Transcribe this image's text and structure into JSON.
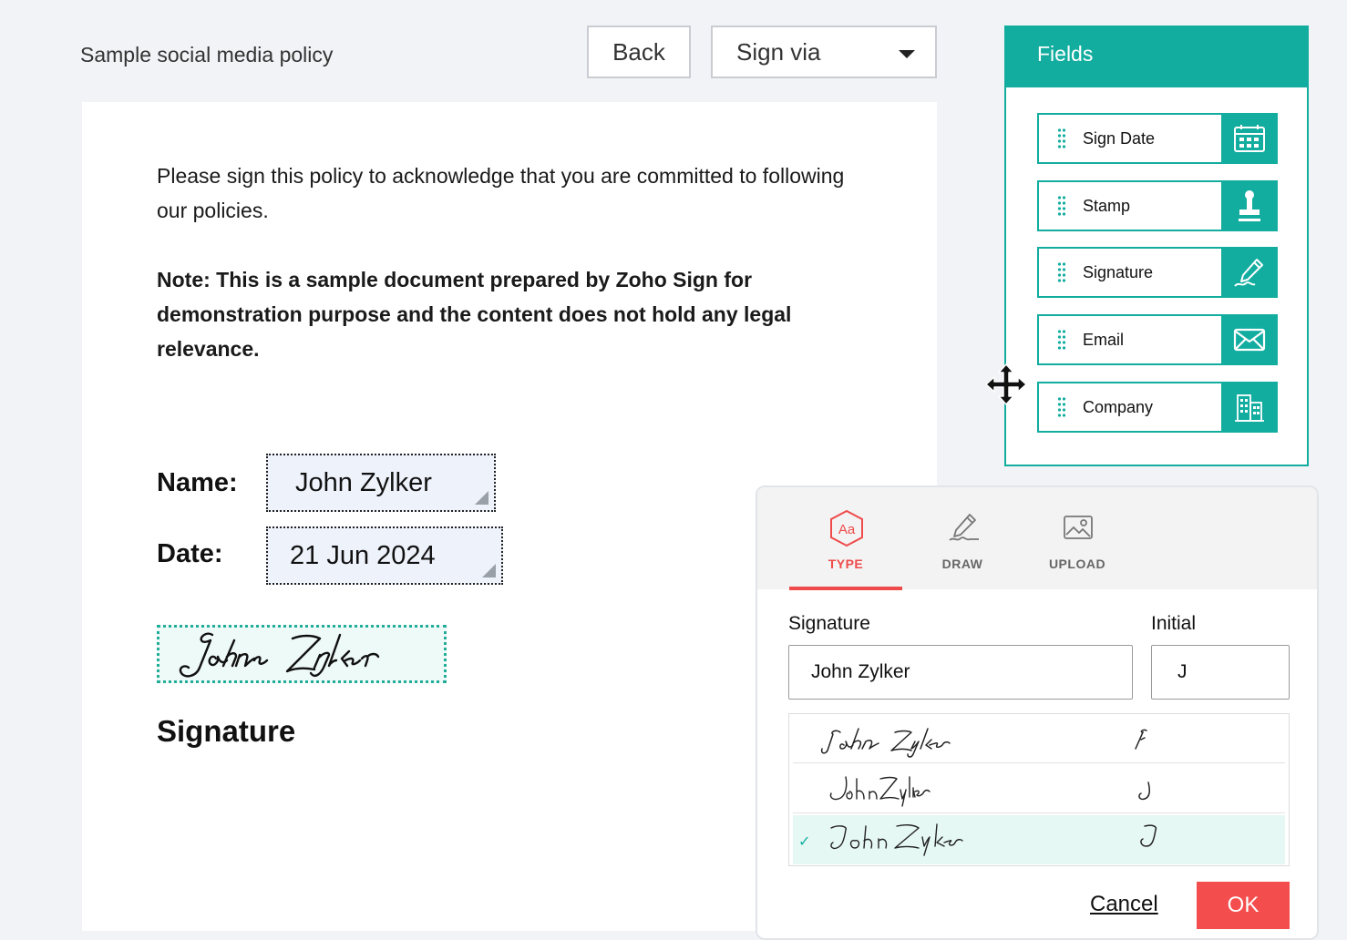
{
  "header": {
    "doc_title": "Sample social media policy",
    "back_label": "Back",
    "sign_via_label": "Sign via"
  },
  "document": {
    "paragraph": "Please sign this policy to acknowledge that you are committed to following our policies.",
    "note": "Note: This is a sample document prepared by Zoho Sign for demonstration purpose and the content does not hold any legal relevance.",
    "name_label": "Name:",
    "name_value": "John Zylker",
    "date_label": "Date:",
    "date_value": "21 Jun 2024",
    "signature_label": "Signature",
    "signature_image_text": "John Zylker"
  },
  "fields_panel": {
    "title": "Fields",
    "items": [
      {
        "label": "Sign Date",
        "icon": "calendar-icon"
      },
      {
        "label": "Stamp",
        "icon": "stamp-icon"
      },
      {
        "label": "Signature",
        "icon": "pen-icon"
      },
      {
        "label": "Email",
        "icon": "envelope-icon"
      },
      {
        "label": "Company",
        "icon": "building-icon"
      }
    ]
  },
  "dialog": {
    "tabs": [
      {
        "label": "TYPE",
        "icon": "type-aa-icon",
        "active": true
      },
      {
        "label": "DRAW",
        "icon": "draw-pen-icon",
        "active": false
      },
      {
        "label": "UPLOAD",
        "icon": "image-icon",
        "active": false
      }
    ],
    "signature_label": "Signature",
    "initial_label": "Initial",
    "signature_value": "John Zylker",
    "initial_value": "J",
    "style_options": [
      {
        "signature": "John Zylker",
        "initial": "J",
        "selected": false
      },
      {
        "signature": "John Zylker",
        "initial": "J",
        "selected": false
      },
      {
        "signature": "John Zylker",
        "initial": "J",
        "selected": true
      }
    ],
    "cancel_label": "Cancel",
    "ok_label": "OK"
  },
  "colors": {
    "accent_teal": "#13ada0",
    "accent_red": "#f44d4d",
    "background": "#f2f3f7"
  }
}
